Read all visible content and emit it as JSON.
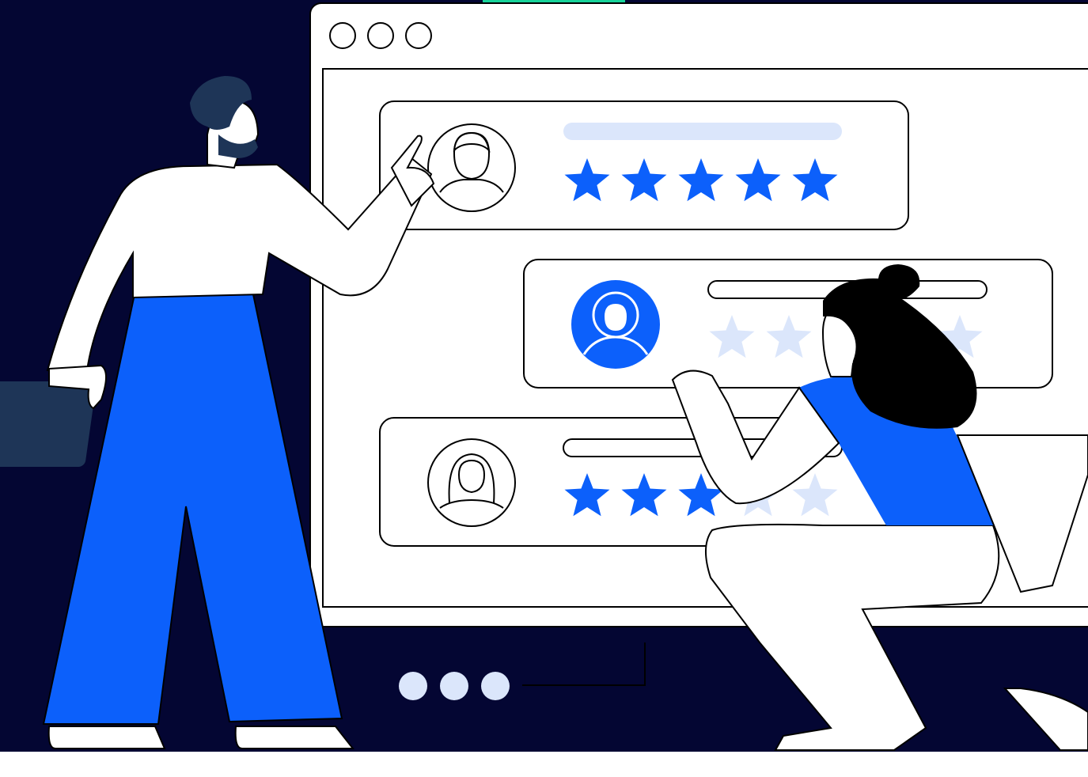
{
  "colors": {
    "navy": "#040633",
    "blue": "#0c60fb",
    "light_blue": "#dbe6fb",
    "dark_slate": "#1e3557",
    "outline": "#000000",
    "white": "#ffffff"
  },
  "browser": {
    "window_controls": [
      "circle-button",
      "circle-button",
      "circle-button"
    ],
    "pager_dots": 3
  },
  "reviews": [
    {
      "avatar": "male-avatar-icon",
      "rating": 5,
      "max_rating": 5,
      "highlight": false
    },
    {
      "avatar": "female-curly-avatar-icon",
      "rating": 0,
      "max_rating": 5,
      "highlight": true
    },
    {
      "avatar": "female-avatar-icon",
      "rating": 3,
      "max_rating": 5,
      "highlight": false
    }
  ]
}
